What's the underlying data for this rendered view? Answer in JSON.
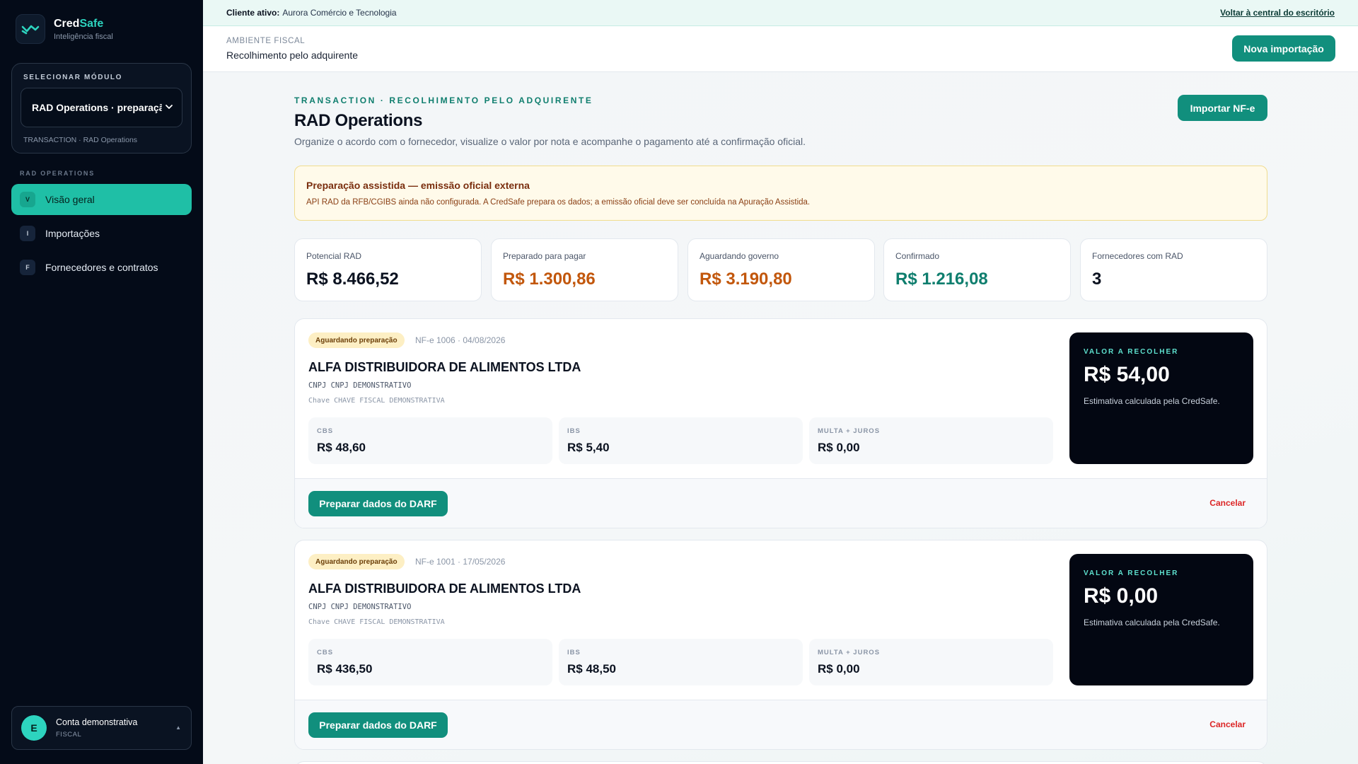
{
  "brand": {
    "name_main": "Cred",
    "name_accent": "Safe",
    "subtitle": "Inteligência fiscal"
  },
  "module": {
    "title": "SELECIONAR MÓDULO",
    "selected": "RAD Operations · preparação",
    "footer": "TRANSACTION · RAD Operations"
  },
  "nav": {
    "section": "RAD OPERATIONS",
    "items": [
      {
        "badge": "V",
        "label": "Visão geral",
        "active": true
      },
      {
        "badge": "I",
        "label": "Importações",
        "active": false
      },
      {
        "badge": "F",
        "label": "Fornecedores e contratos",
        "active": false
      }
    ]
  },
  "account": {
    "initial": "E",
    "name": "Conta demonstrativa",
    "role": "FISCAL",
    "caret": "▲"
  },
  "topbar": {
    "label": "Cliente ativo:",
    "value": "Aurora Comércio e Tecnologia",
    "link": "Voltar à central do escritório"
  },
  "subbar": {
    "label": "AMBIENTE FISCAL",
    "value": "Recolhimento pelo adquirente",
    "button": "Nova importação"
  },
  "page": {
    "eyebrow": "TRANSACTION · RECOLHIMENTO PELO ADQUIRENTE",
    "title": "RAD Operations",
    "description": "Organize o acordo com o fornecedor, visualize o valor por nota e acompanhe o pagamento até a confirmação oficial.",
    "import_button": "Importar NF-e"
  },
  "alert": {
    "title": "Preparação assistida — emissão oficial externa",
    "text": "API RAD da RFB/CGIBS ainda não configurada. A CredSafe prepara os dados; a emissão oficial deve ser concluída na Apuração Assistida."
  },
  "stats": [
    {
      "label": "Potencial RAD",
      "value": "R$ 8.466,52",
      "color": "#0b1220"
    },
    {
      "label": "Preparado para pagar",
      "value": "R$ 1.300,86",
      "color": "#c2570c"
    },
    {
      "label": "Aguardando governo",
      "value": "R$ 3.190,80",
      "color": "#c2570c"
    },
    {
      "label": "Confirmado",
      "value": "R$ 1.216,08",
      "color": "#0f7e6e"
    },
    {
      "label": "Fornecedores com RAD",
      "value": "3",
      "color": "#0b1220"
    }
  ],
  "invoices": [
    {
      "status": "Aguardando preparação",
      "meta": "NF-e 1006 · 04/08/2026",
      "supplier": "ALFA DISTRIBUIDORA DE ALIMENTOS LTDA",
      "cnpj": "CNPJ CNPJ DEMONSTRATIVO",
      "key": "Chave CHAVE FISCAL DEMONSTRATIVA",
      "cbs_label": "CBS",
      "cbs": "R$ 48,60",
      "ibs_label": "IBS",
      "ibs": "R$ 5,40",
      "fine_label": "MULTA + JUROS",
      "fine": "R$ 0,00",
      "panel_label": "VALOR A RECOLHER",
      "total": "R$ 54,00",
      "panel_note": "Estimativa calculada pela CredSafe.",
      "action": "Preparar dados do DARF",
      "cancel": "Cancelar"
    },
    {
      "status": "Aguardando preparação",
      "meta": "NF-e 1001 · 17/05/2026",
      "supplier": "ALFA DISTRIBUIDORA DE ALIMENTOS LTDA",
      "cnpj": "CNPJ CNPJ DEMONSTRATIVO",
      "key": "Chave CHAVE FISCAL DEMONSTRATIVA",
      "cbs_label": "CBS",
      "cbs": "R$ 436,50",
      "ibs_label": "IBS",
      "ibs": "R$ 48,50",
      "fine_label": "MULTA + JUROS",
      "fine": "R$ 0,00",
      "panel_label": "VALOR A RECOLHER",
      "total": "R$ 0,00",
      "panel_note": "Estimativa calculada pela CredSafe.",
      "action": "Preparar dados do DARF",
      "cancel": "Cancelar"
    }
  ],
  "colors": {
    "accent": "#118f7d",
    "nav_active": "#1fbfa6",
    "sidebar_bg": "#040b18",
    "warning": "#c2570c",
    "success": "#0f7e6e",
    "danger": "#dc2626"
  },
  "icons": {
    "logo": "credsafe-logo-icon",
    "select": "chevron-down-icon"
  }
}
